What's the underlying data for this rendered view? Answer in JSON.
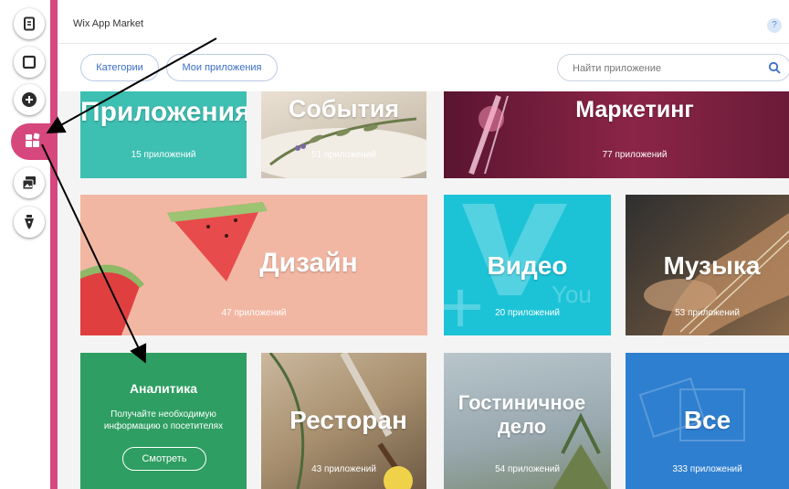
{
  "app_title": "Wix App Market",
  "help_label": "?",
  "nav": {
    "categories_label": "Категории",
    "my_apps_label": "Мои приложения",
    "search_placeholder": "Найти приложение"
  },
  "left_toolbar": [
    "pages-icon",
    "background-icon",
    "add-icon",
    "app-market-icon",
    "media-icon",
    "blog-pen-icon"
  ],
  "accent_color": "#d6477d",
  "tiles": {
    "apps": {
      "name": "Приложения",
      "count": "15 приложений",
      "color": "#3dbfb1"
    },
    "events": {
      "name": "События",
      "count": "51 приложений"
    },
    "marketing": {
      "name": "Маркетинг",
      "count": "77 приложений",
      "color": "#7a1f3e"
    },
    "design": {
      "name": "Дизайн",
      "count": "47 приложений",
      "color": "#f2b7a3"
    },
    "video": {
      "name": "Видео",
      "count": "20 приложений",
      "color": "#1cc3d6"
    },
    "music": {
      "name": "Музыка",
      "count": "53 приложений"
    },
    "analytics": {
      "name": "Аналитика",
      "desc_line1": "Получайте необходимую",
      "desc_line2": "информацию о посетителях",
      "button": "Смотреть",
      "color": "#2e9e62"
    },
    "restaurant": {
      "name": "Ресторан",
      "count": "43 приложений"
    },
    "hospitality": {
      "name_line1": "Гостиничное",
      "name_line2": "дело",
      "count": "54 приложений"
    },
    "all": {
      "name": "Все",
      "count": "333 приложений",
      "color": "#2f7fd0"
    }
  }
}
